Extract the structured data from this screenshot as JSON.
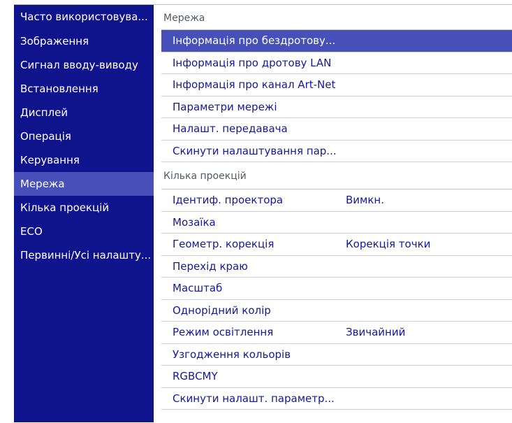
{
  "sidebar": {
    "items": [
      {
        "label": "Часто використовува..."
      },
      {
        "label": "Зображення"
      },
      {
        "label": "Сигнал вводу-виводу"
      },
      {
        "label": "Встановлення"
      },
      {
        "label": "Дисплей"
      },
      {
        "label": "Операція"
      },
      {
        "label": "Керування"
      },
      {
        "label": "Мережа"
      },
      {
        "label": "Кілька проекцій"
      },
      {
        "label": "ECO"
      },
      {
        "label": "Первинні/Усі налашту..."
      }
    ]
  },
  "network": {
    "header": "Мережа",
    "items": [
      {
        "label": "Інформація про бездротову..."
      },
      {
        "label": "Інформація про дротову LAN"
      },
      {
        "label": "Інформація про канал Art-Net"
      },
      {
        "label": "Параметри мережі"
      },
      {
        "label": "Налашт. передавача"
      },
      {
        "label": "Скинути налаштування пар..."
      }
    ]
  },
  "multi": {
    "header": "Кілька проекцій",
    "items": [
      {
        "label": "Ідентиф. проектора",
        "value": "Вимкн."
      },
      {
        "label": "Мозаїка",
        "value": ""
      },
      {
        "label": "Геометр. корекція",
        "value": "Корекція точки"
      },
      {
        "label": "Перехід краю",
        "value": ""
      },
      {
        "label": "Масштаб",
        "value": ""
      },
      {
        "label": "Однорідний колір",
        "value": ""
      },
      {
        "label": "Режим освітлення",
        "value": "Звичайний"
      },
      {
        "label": "Узгодження кольорів",
        "value": ""
      },
      {
        "label": "RGBCMY",
        "value": ""
      },
      {
        "label": "Скинути налашт. параметр...",
        "value": ""
      }
    ]
  },
  "colors": {
    "sidebar_bg": "#10148c",
    "active_bg": "#4650b8",
    "item_text": "#14189a"
  }
}
